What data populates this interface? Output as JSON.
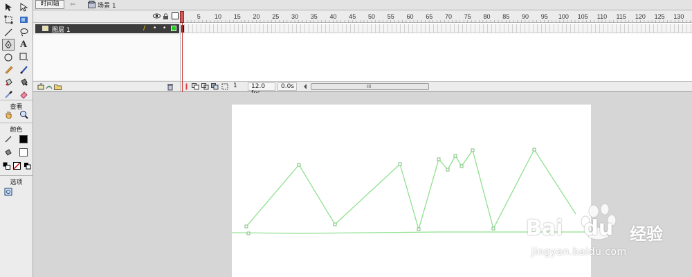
{
  "timeline_bar": {
    "tab_label": "时间轴",
    "back_arrow": "⇐",
    "scene_name": "场景 1"
  },
  "layers": {
    "header_icons": [
      "eye-icon",
      "lock-icon",
      "outline-icon"
    ],
    "items": [
      {
        "name": "图层 1",
        "pencil": "/",
        "dot1": "•",
        "dot2": "•",
        "color": "#22aa22"
      }
    ]
  },
  "ruler": {
    "labels": [
      "5",
      "10",
      "15",
      "20",
      "25",
      "30",
      "35",
      "40",
      "45",
      "50",
      "55",
      "60",
      "65",
      "70",
      "75",
      "80",
      "85",
      "90",
      "95",
      "100",
      "105",
      "110",
      "115",
      "120",
      "125",
      "130"
    ]
  },
  "status": {
    "current_frame": "1",
    "frame_rate": "12.0 fps",
    "elapsed_time": "0.0s",
    "scroll_grip": "III"
  },
  "tools": {
    "view_label": "查看",
    "color_label": "颜色",
    "options_label": "选项",
    "text_tool": "A",
    "stroke_color": "#000000",
    "fill_color": "#ffffff"
  },
  "stage": {
    "line_color": "#8fe08f",
    "background": "#ffffff"
  },
  "watermark": {
    "brand": "Bai",
    "brand2": "du",
    "cn_text": "经验",
    "url": "jingyan.baidu.com"
  }
}
